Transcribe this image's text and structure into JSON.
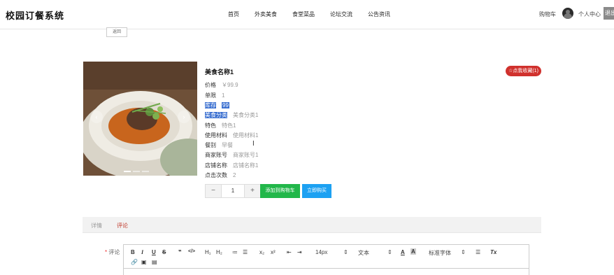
{
  "header": {
    "site_title": "校园订餐系统",
    "nav": [
      "首页",
      "外卖美食",
      "食堂菜品",
      "论坛交流",
      "公告资讯"
    ],
    "cart": "购物车",
    "user_center": "个人中心",
    "logout": "退出"
  },
  "back_label": "返回",
  "product": {
    "name": "美食名称1",
    "favorite_button": "☆点我收藏(1)",
    "rows": [
      {
        "label": "价格",
        "value": "￥99.9"
      },
      {
        "label": "单限",
        "value": "1"
      },
      {
        "label": "库存",
        "value": "99"
      },
      {
        "label": "美食分类",
        "value": "美食分类1"
      },
      {
        "label": "特色",
        "value": "特色1"
      },
      {
        "label": "使用材料",
        "value": "使用材料1"
      },
      {
        "label": "餐别",
        "value": "早餐"
      },
      {
        "label": "商家账号",
        "value": "商家账号1"
      },
      {
        "label": "店铺名称",
        "value": "店铺名称1"
      },
      {
        "label": "点击次数",
        "value": "2"
      }
    ],
    "quantity": "1",
    "minus": "−",
    "plus": "+",
    "add_to_cart": "添加到购物车",
    "buy_now": "立即购买"
  },
  "carousel": {
    "prev": "‹",
    "next": "›"
  },
  "tabs": {
    "detail": "详情",
    "comment": "评论"
  },
  "comment": {
    "required_mark": "*",
    "label": "评论",
    "toolbar": {
      "bold": "B",
      "italic": "I",
      "underline": "U",
      "strike": "S",
      "quote": "❞",
      "code": "</>",
      "h1": "H₁",
      "h2": "H₂",
      "ol": "≔",
      "ul": "☰",
      "sub": "x₂",
      "sup": "x²",
      "indent_left": "⇤",
      "indent_right": "⇥",
      "size": "14px",
      "header": "文本",
      "font": "标准字体",
      "clean": "Tx"
    }
  },
  "colors": {
    "favorite": "#d0312d",
    "add_cart": "#22b74a",
    "buy_now": "#1da1f2",
    "highlight": "#3a6fd0",
    "tab_active": "#c0392b"
  }
}
